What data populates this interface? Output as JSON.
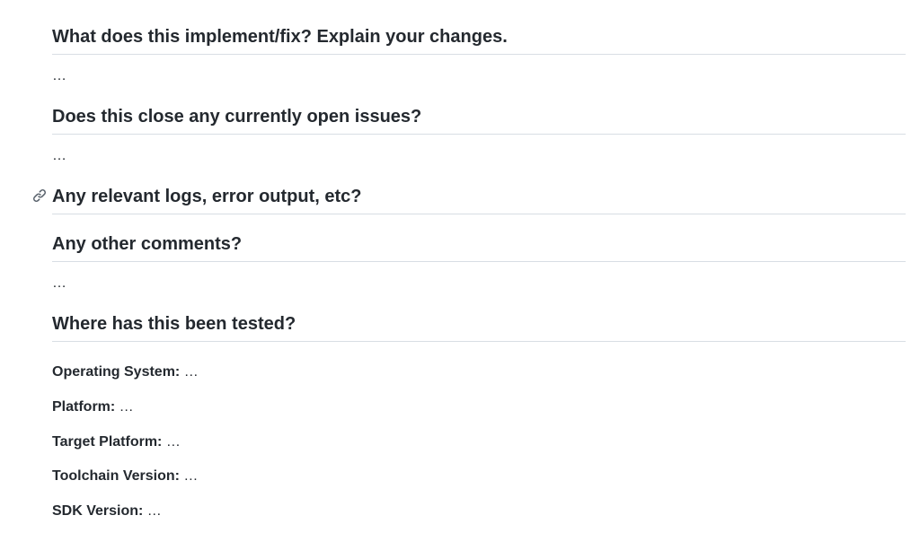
{
  "sections": {
    "implement": {
      "heading": "What does this implement/fix? Explain your changes.",
      "placeholder": "…"
    },
    "closes": {
      "heading": "Does this close any currently open issues?",
      "placeholder": "…"
    },
    "logs": {
      "heading": "Any relevant logs, error output, etc?"
    },
    "comments": {
      "heading": "Any other comments?",
      "placeholder": "…"
    },
    "tested": {
      "heading": "Where has this been tested?",
      "items": [
        {
          "label": "Operating System:",
          "value": " …"
        },
        {
          "label": "Platform:",
          "value": " …"
        },
        {
          "label": "Target Platform:",
          "value": " …"
        },
        {
          "label": "Toolchain Version:",
          "value": " …"
        },
        {
          "label": "SDK Version:",
          "value": " …"
        }
      ]
    }
  }
}
